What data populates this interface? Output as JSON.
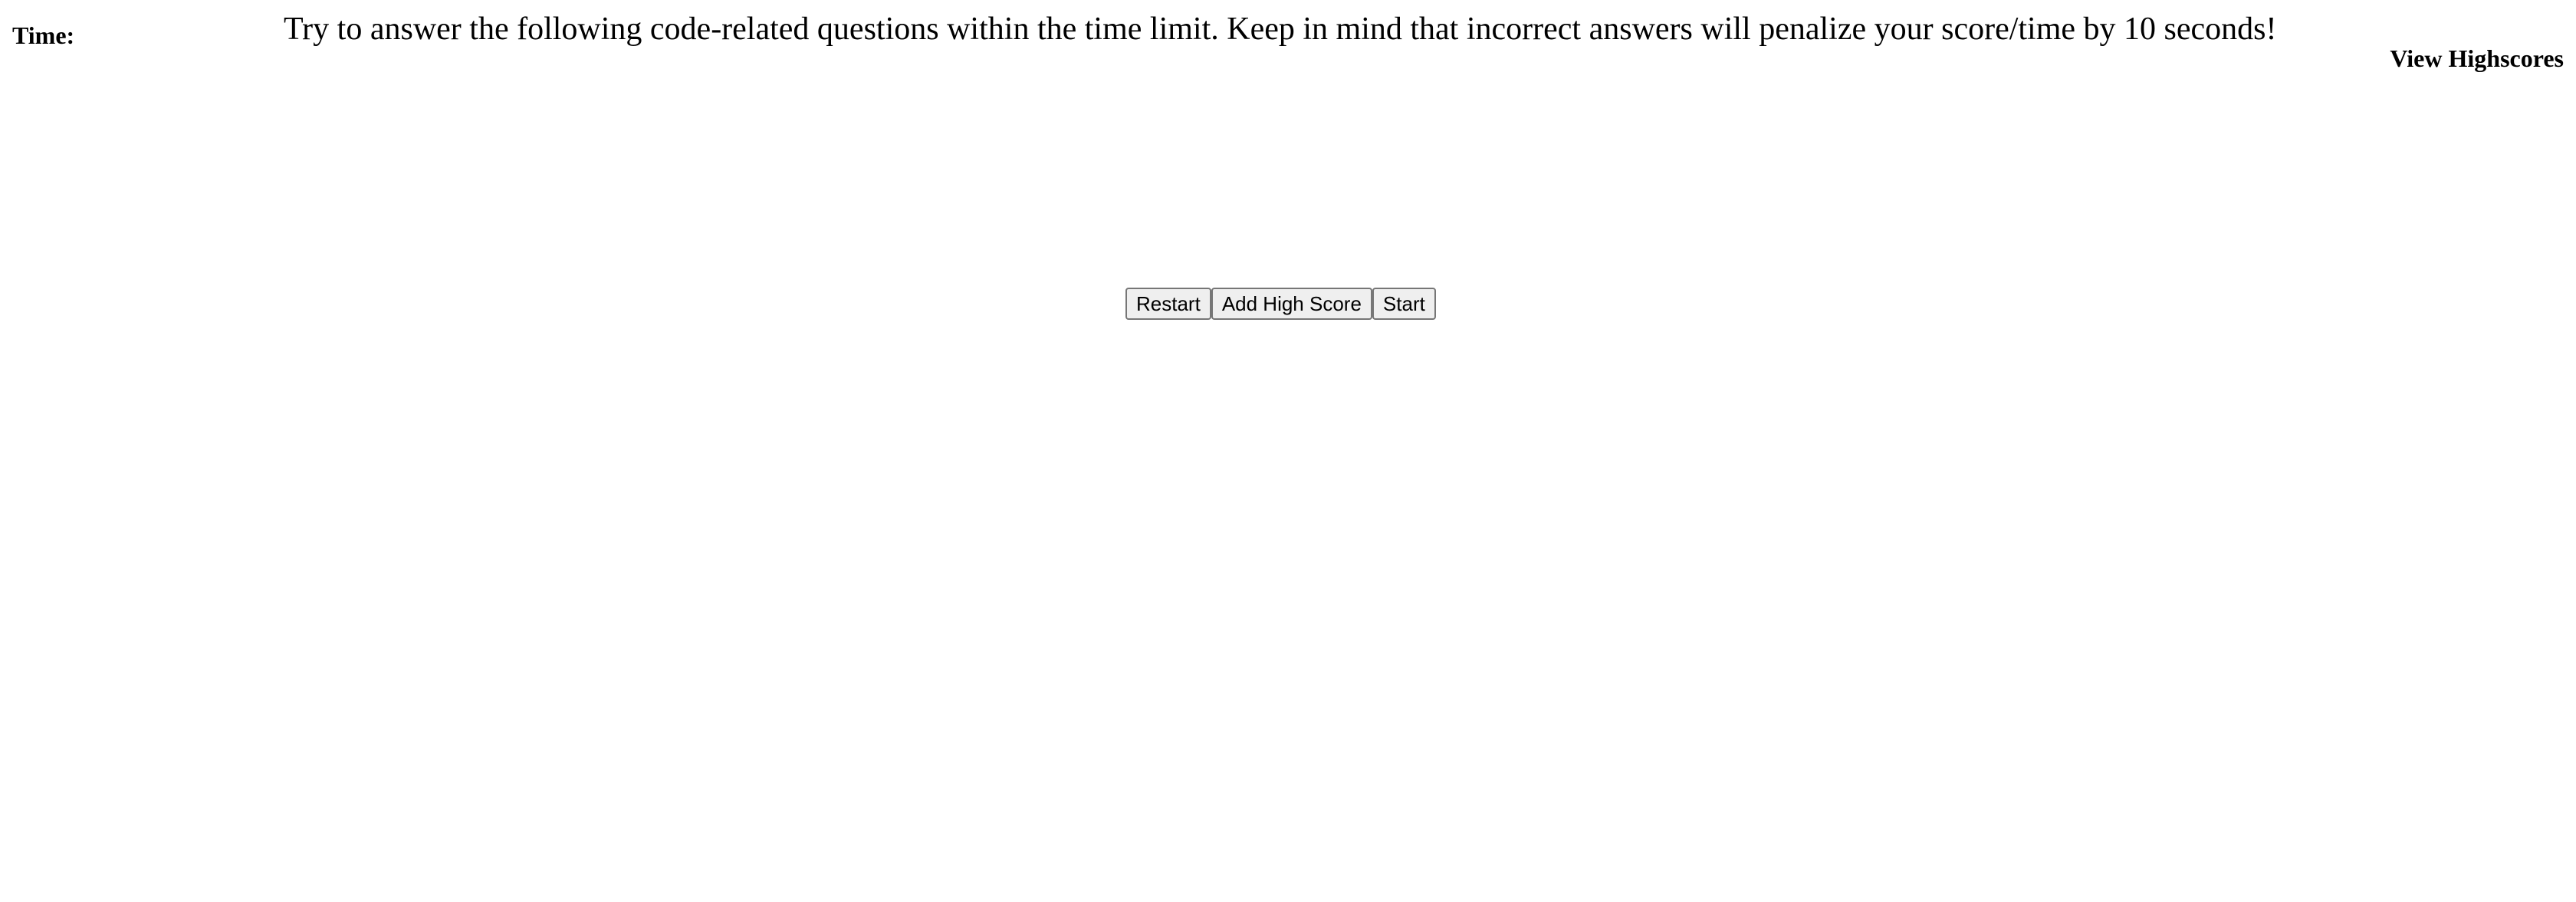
{
  "header": {
    "timer_label": "Time:",
    "timer_value": "",
    "instructions": "Try to answer the following code-related questions within the time limit. Keep in mind that incorrect answers will penalize your score/time by 10 seconds!",
    "highscores_link": "View Highscores"
  },
  "controls": {
    "restart_label": "Restart",
    "add_high_score_label": "Add High Score",
    "start_label": "Start"
  }
}
